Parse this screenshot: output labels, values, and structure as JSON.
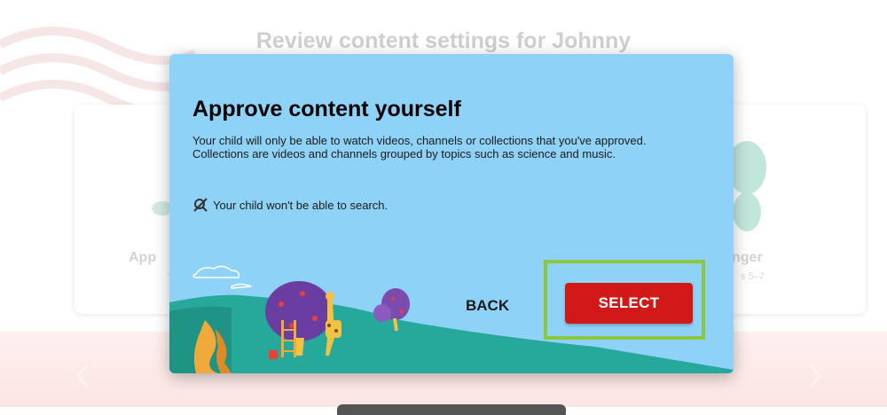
{
  "background": {
    "page_title": "Review content settings for Johnny",
    "left_card_label": "App",
    "left_card_sub": "Y",
    "right_card_label": "nger",
    "right_card_sub": "s 5–7"
  },
  "dialog": {
    "title": "Approve content yourself",
    "body": "Your child will only be able to watch videos, channels or collections that you've approved. Collections are videos and channels grouped by topics such as science and music.",
    "note": "Your child won't be able to search.",
    "note_icon": "search-off-icon",
    "back_label": "BACK",
    "select_label": "SELECT"
  },
  "colors": {
    "dialog_bg": "#8fd2f8",
    "select_button": "#d11a17",
    "highlight": "#8dc63f"
  }
}
